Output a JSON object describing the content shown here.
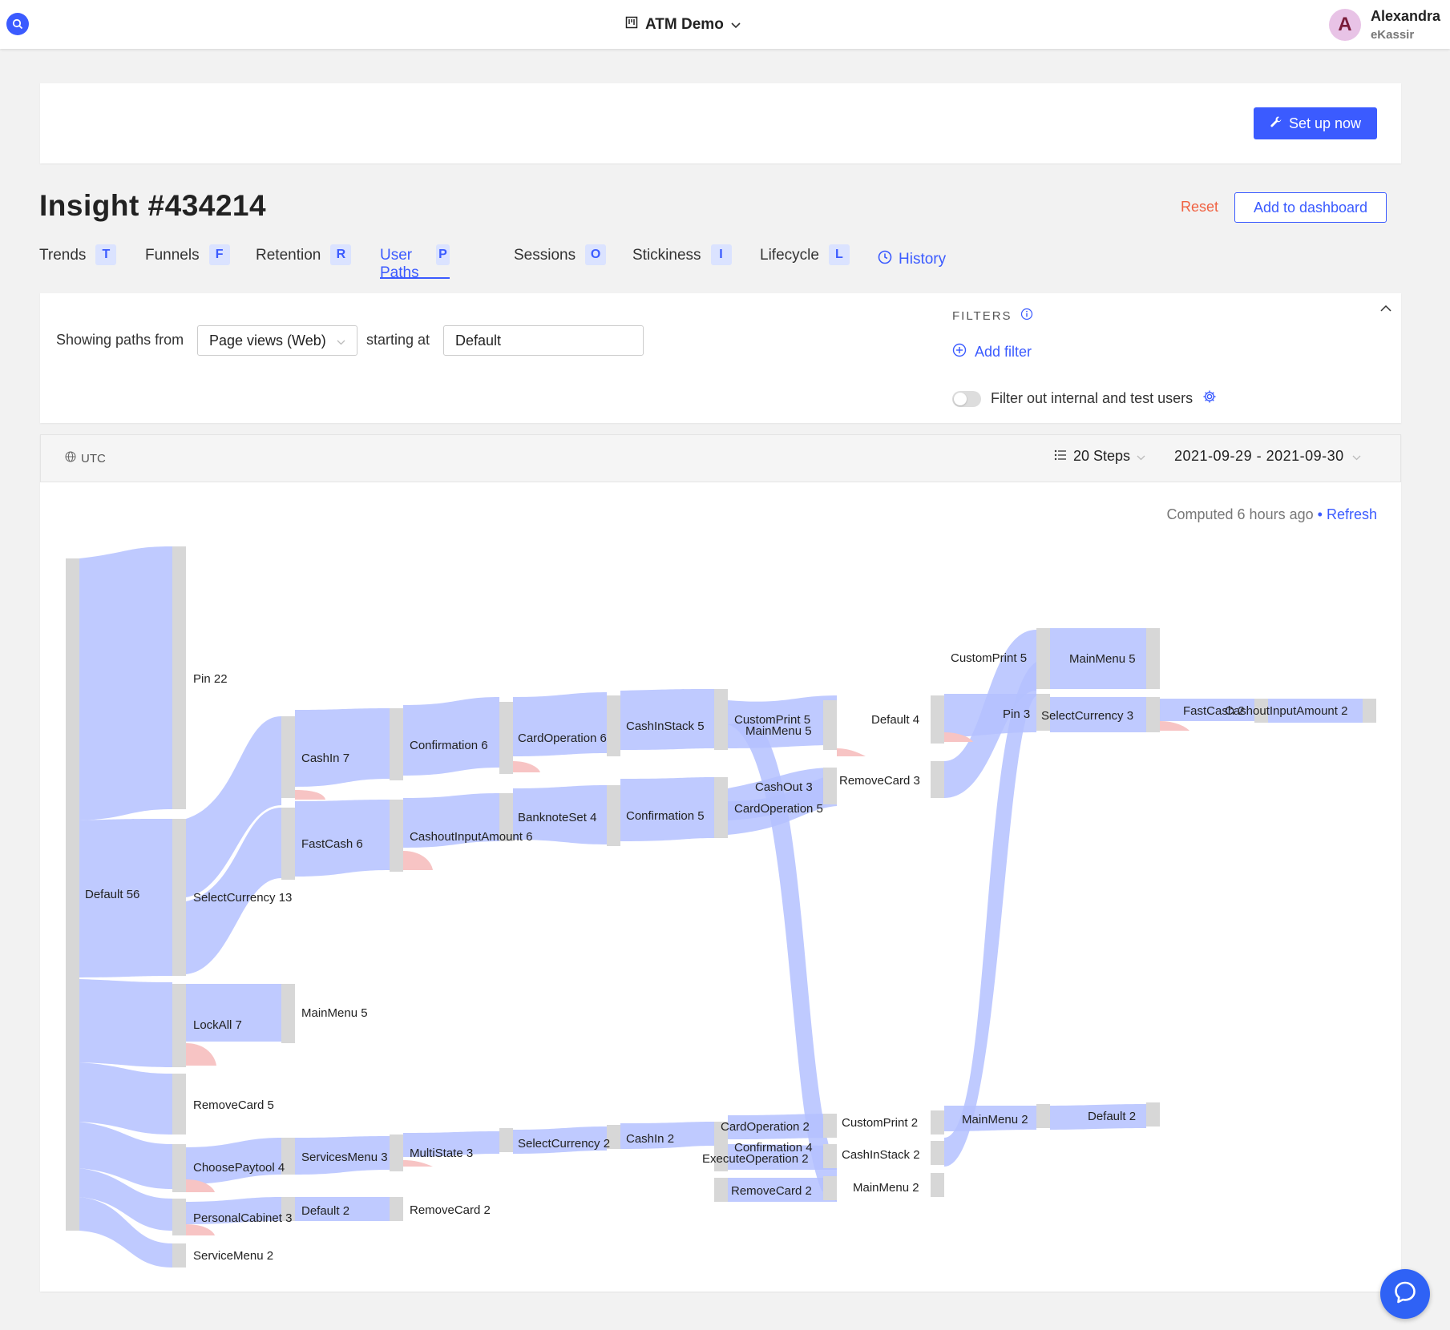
{
  "topbar": {
    "project_name": "ATM Demo",
    "user_initial": "A",
    "user_name": "Alexandra",
    "user_org": "eKassir"
  },
  "setup": {
    "button_label": "Set up now"
  },
  "insight": {
    "title": "Insight #434214",
    "reset_label": "Reset",
    "add_dashboard_label": "Add to dashboard"
  },
  "tabs": [
    {
      "label": "Trends",
      "key": "T"
    },
    {
      "label": "Funnels",
      "key": "F"
    },
    {
      "label": "Retention",
      "key": "R"
    },
    {
      "label": "User Paths",
      "key": "P"
    },
    {
      "label": "Sessions",
      "key": "O"
    },
    {
      "label": "Stickiness",
      "key": "I"
    },
    {
      "label": "Lifecycle",
      "key": "L"
    }
  ],
  "history_label": "History",
  "query": {
    "showing_label": "Showing paths from",
    "path_type": "Page views (Web)",
    "starting_label": "starting at",
    "start_value": "Default"
  },
  "filters": {
    "heading": "FILTERS",
    "add_label": "Add filter",
    "toggle_label": "Filter out internal and test users",
    "toggle_on": false
  },
  "paths": {
    "timezone": "UTC",
    "steps_label": "20 Steps",
    "date_range": "2021-09-29 - 2021-09-30",
    "computed_text": "Computed 6 hours ago",
    "separator": "•",
    "refresh_label": "Refresh"
  },
  "colors": {
    "accent": "#3b5bff",
    "link": "#b4c1ff",
    "node": "#d7d7d7",
    "dropoff": "#f7c4c4",
    "reset": "#f06242"
  },
  "sankey_nodes": [
    {
      "label": "Default 56"
    },
    {
      "label": "Pin 22"
    },
    {
      "label": "SelectCurrency 13"
    },
    {
      "label": "LockAll 7"
    },
    {
      "label": "RemoveCard 5"
    },
    {
      "label": "ChoosePaytool 4"
    },
    {
      "label": "PersonalCabinet 3"
    },
    {
      "label": "ServiceMenu 2"
    },
    {
      "label": "CashIn 7"
    },
    {
      "label": "FastCash 6"
    },
    {
      "label": "MainMenu 5"
    },
    {
      "label": "ServicesMenu 3"
    },
    {
      "label": "Default 2"
    },
    {
      "label": "Confirmation 6"
    },
    {
      "label": "CashoutInputAmount 6"
    },
    {
      "label": "MultiState 3"
    },
    {
      "label": "RemoveCard 2"
    },
    {
      "label": "CardOperation 6"
    },
    {
      "label": "BanknoteSet 4"
    },
    {
      "label": "SelectCurrency 2"
    },
    {
      "label": "CashInStack 5"
    },
    {
      "label": "Confirmation 5"
    },
    {
      "label": "CashIn 2"
    },
    {
      "label": "CustomPrint 5"
    },
    {
      "label": "MainMenu 5"
    },
    {
      "label": "CashOut 3"
    },
    {
      "label": "CardOperation 5"
    },
    {
      "label": "CardOperation 2"
    },
    {
      "label": "Confirmation 4"
    },
    {
      "label": "ExecuteOperation 2"
    },
    {
      "label": "RemoveCard 2"
    },
    {
      "label": "Default 4"
    },
    {
      "label": "RemoveCard 3"
    },
    {
      "label": "CustomPrint 2"
    },
    {
      "label": "CashInStack 2"
    },
    {
      "label": "MainMenu 2"
    },
    {
      "label": "CustomPrint 5"
    },
    {
      "label": "Pin 3"
    },
    {
      "label": "MainMenu 2"
    },
    {
      "label": "MainMenu 5"
    },
    {
      "label": "SelectCurrency 3"
    },
    {
      "label": "Default 2"
    },
    {
      "label": "FastCash 2"
    },
    {
      "label": "CashoutInputAmount 2"
    }
  ]
}
